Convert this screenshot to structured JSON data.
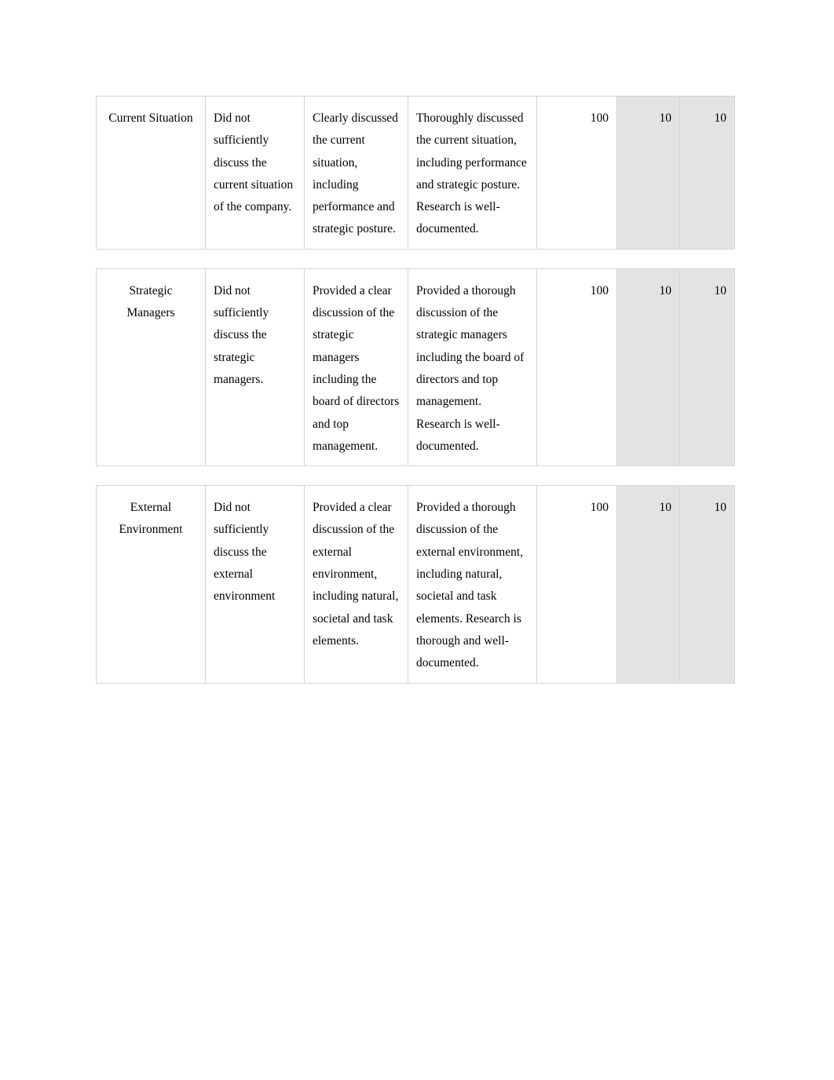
{
  "document": {
    "type": "rubric-table",
    "page_background": "#ffffff",
    "criterion_cell_background": "#e3e3e3",
    "border_color": "#d4d4d4"
  },
  "table": {
    "columns": [
      {
        "key": "criterion",
        "kind": "criterion"
      },
      {
        "key": "below",
        "kind": "level"
      },
      {
        "key": "meets",
        "kind": "level"
      },
      {
        "key": "exceeds",
        "kind": "level"
      },
      {
        "key": "score",
        "kind": "number",
        "shaded": false
      },
      {
        "key": "weight",
        "kind": "number",
        "shaded": true
      },
      {
        "key": "points",
        "kind": "number",
        "shaded": true
      }
    ],
    "rows": [
      {
        "criterion": "Current Situation",
        "below": "Did not sufficiently discuss the current situation of the company.",
        "meets": "Clearly discussed the current situation, including performance and strategic posture.",
        "exceeds": "Thoroughly discussed the current situation, including performance and strategic posture. Research is well-documented.",
        "score": "100",
        "weight": "10",
        "points": "10"
      },
      {
        "criterion": "Strategic Managers",
        "below": "Did not sufficiently discuss the strategic managers.",
        "meets": "Provided a clear discussion of the strategic managers including the board of directors and top management.",
        "exceeds": "Provided a thorough discussion of the strategic managers including the board of directors and top management. Research is well-documented.",
        "score": "100",
        "weight": "10",
        "points": "10"
      },
      {
        "criterion": "External Environment",
        "below": "Did not sufficiently discuss the external environment",
        "meets": "Provided a clear discussion of the external environment, including natural, societal and task elements.",
        "exceeds": "Provided a thorough discussion of the external environment, including natural, societal and task elements. Research is thorough and well-documented.",
        "score": "100",
        "weight": "10",
        "points": "10"
      }
    ]
  }
}
